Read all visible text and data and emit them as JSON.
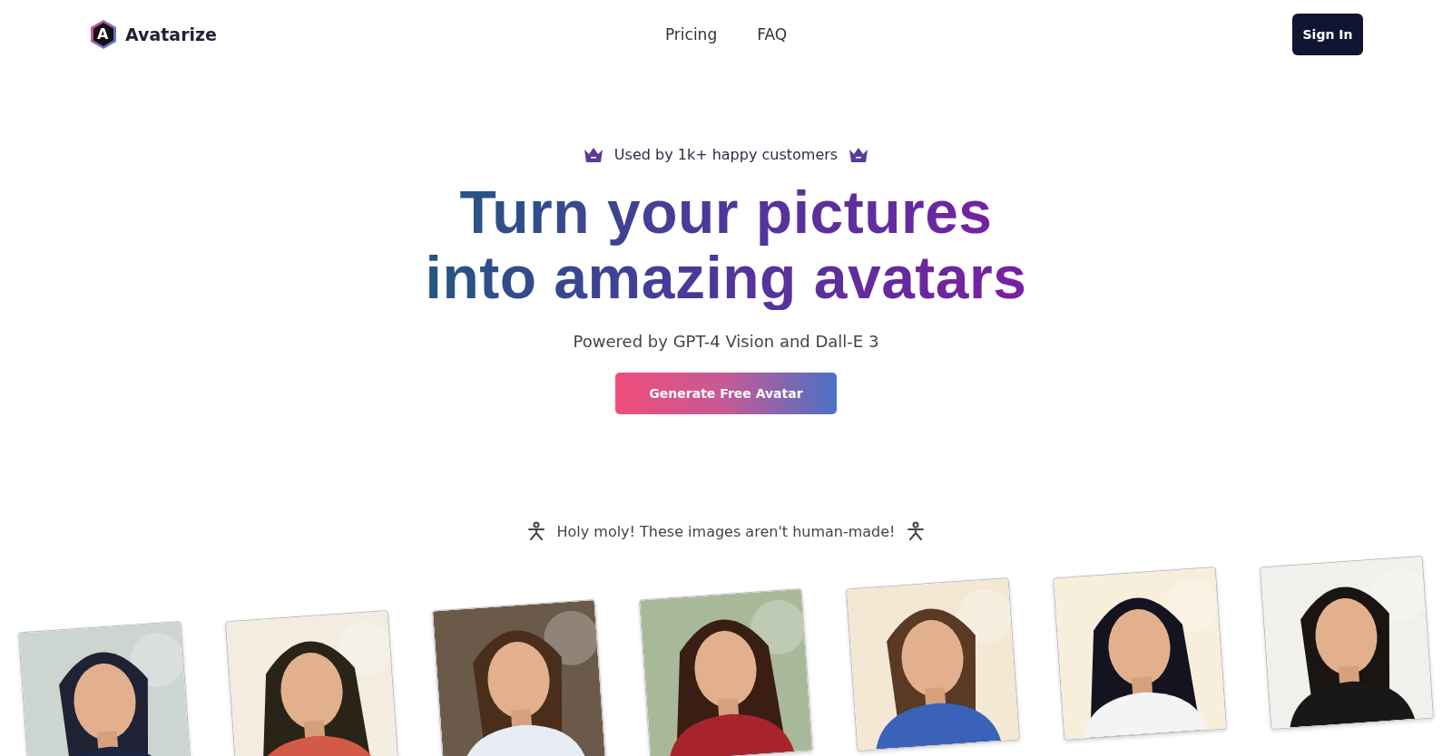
{
  "header": {
    "brand": "Avatarize",
    "letter": "A",
    "nav": [
      "Pricing",
      "FAQ"
    ],
    "sign_in": "Sign In"
  },
  "hero": {
    "badge": "Used by 1k+ happy customers",
    "title_lines": [
      "Turn your pictures",
      "into amazing avatars"
    ],
    "subtitle": "Powered by GPT-4 Vision and Dall-E 3",
    "cta": "Generate Free Avatar"
  },
  "gallery": {
    "caption": "Holy moly! These images aren't human-made!"
  }
}
